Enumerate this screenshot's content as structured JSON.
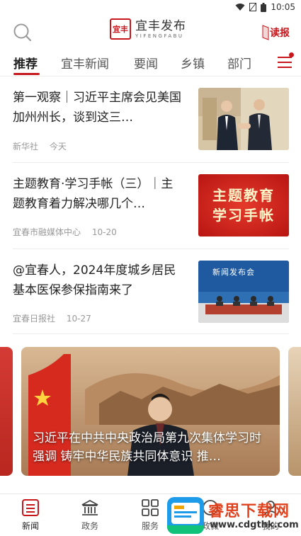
{
  "status_bar": {
    "time": "10:05"
  },
  "header": {
    "logo_cn": "宜丰发布",
    "logo_en": "YIFENGFABU",
    "seal_text": "宜丰",
    "read_label": "读报"
  },
  "tabs": [
    "推荐",
    "宜丰新闻",
    "要闻",
    "乡镇",
    "部门"
  ],
  "news": [
    {
      "title": "第一观察｜习近平主席会见美国加州州长，谈到这三…",
      "source": "新华社",
      "time": "今天"
    },
    {
      "title": "主题教育·学习手帐（三）｜主题教育着力解决哪几个…",
      "source": "宜春市融媒体中心",
      "time": "10-20",
      "thumb_text": [
        "主题教育",
        "学习手帐"
      ]
    },
    {
      "title": "@宜春人，2024年度城乡居民基本医保参保指南来了",
      "source": "宜春日报社",
      "time": "10-27",
      "thumb_text": "新闻发布会"
    }
  ],
  "carousel": {
    "caption": "习近平在中共中央政治局第九次集体学习时强调 铸牢中华民族共同体意识 推…"
  },
  "bottom_nav": [
    {
      "label": "新闻",
      "icon": "news-icon"
    },
    {
      "label": "政务",
      "icon": "government-building-icon"
    },
    {
      "label": "服务",
      "icon": "grid-services-icon"
    },
    {
      "label": "政微",
      "icon": "micro-icon"
    },
    {
      "label": "我的",
      "icon": "user-icon"
    }
  ],
  "watermark": {
    "cn": "睿思下载网",
    "url": "www.cdgthk.com"
  },
  "colors": {
    "accent": "#c8161d"
  }
}
